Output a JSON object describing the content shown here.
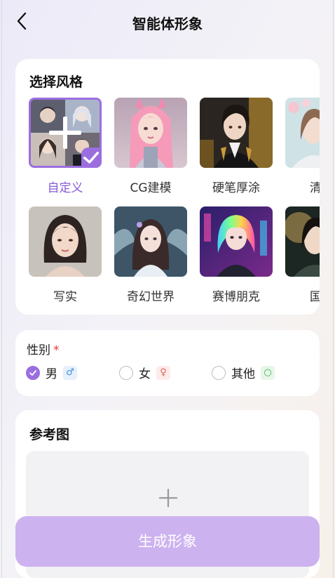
{
  "header": {
    "title": "智能体形象",
    "back_icon": "chevron-left-icon"
  },
  "style_section": {
    "title": "选择风格",
    "selected_index": 0,
    "items": [
      {
        "label": "自定义",
        "image": "custom-collage-with-plus-icon"
      },
      {
        "label": "CG建模",
        "image": "cg-pink-hair-girl"
      },
      {
        "label": "硬笔厚涂",
        "image": "anime-man-gold-suit"
      },
      {
        "label": "清新",
        "image": "fresh-style-figure"
      },
      {
        "label": "写实",
        "image": "realistic-woman-portrait"
      },
      {
        "label": "奇幻世界",
        "image": "fantasy-fairy-girl"
      },
      {
        "label": "赛博朋克",
        "image": "cyberpunk-rainbow-hair-girl"
      },
      {
        "label": "国风",
        "image": "chinese-style-figure"
      }
    ]
  },
  "gender": {
    "title": "性别",
    "required_mark": "*",
    "options": [
      {
        "label": "男",
        "checked": true,
        "symbol": "♂",
        "color": "#3a8ee6",
        "bg": "#e6f0fb"
      },
      {
        "label": "女",
        "checked": false,
        "symbol": "♀",
        "color": "#e5604f",
        "bg": "#fdeceb"
      },
      {
        "label": "其他",
        "checked": false,
        "symbol": "○",
        "color": "#3bb34a",
        "bg": "#e7f6e9"
      }
    ]
  },
  "reference": {
    "title": "参考图",
    "upload_icon": "plus-icon"
  },
  "generate_button": {
    "label": "生成形象",
    "color": "#cdb2f0"
  },
  "colors": {
    "accent": "#9b6ee0",
    "card_bg": "#ffffff"
  }
}
